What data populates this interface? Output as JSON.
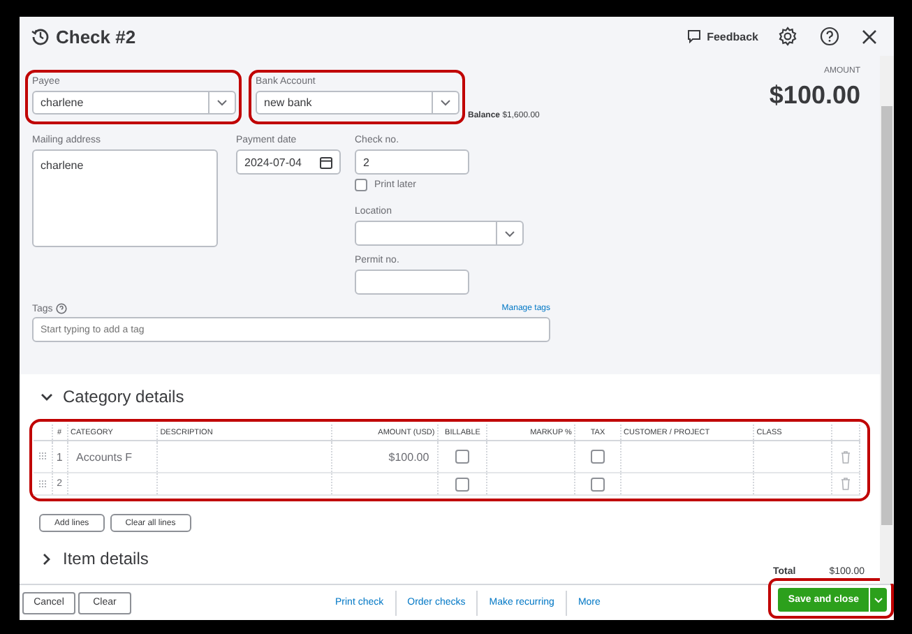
{
  "header": {
    "title": "Check #2",
    "feedback": "Feedback"
  },
  "payee": {
    "label": "Payee",
    "value": "charlene",
    "highlighted": true
  },
  "bank_account": {
    "label": "Bank Account",
    "value": "new bank",
    "highlighted": true,
    "balance_label": "Balance",
    "balance": "$1,600.00"
  },
  "amount": {
    "label": "AMOUNT",
    "value": "$100.00"
  },
  "mailing_address": {
    "label": "Mailing address",
    "value": "charlene"
  },
  "payment_date": {
    "label": "Payment date",
    "value": "2024-07-04"
  },
  "check_no": {
    "label": "Check no.",
    "value": "2"
  },
  "print_later": {
    "label": "Print later",
    "checked": false
  },
  "location": {
    "label": "Location"
  },
  "permit_no": {
    "label": "Permit no."
  },
  "tags": {
    "label": "Tags",
    "placeholder": "Start typing to add a tag",
    "manage": "Manage tags"
  },
  "category_details": {
    "title": "Category details",
    "expanded": true,
    "highlighted": true,
    "columns": [
      "#",
      "CATEGORY",
      "DESCRIPTION",
      "AMOUNT (USD)",
      "BILLABLE",
      "MARKUP %",
      "TAX",
      "CUSTOMER / PROJECT",
      "CLASS"
    ],
    "rows": [
      {
        "number": "1",
        "category": "Accounts F",
        "amount": "$100.00",
        "billable": false,
        "tax": false
      },
      {
        "number": "2",
        "billable": false,
        "tax": false
      }
    ],
    "buttons": [
      "Add lines",
      "Clear all lines"
    ]
  },
  "item_details": {
    "title": "Item details",
    "expanded": false
  },
  "total": {
    "label": "Total",
    "value": "$100.00"
  },
  "footer": {
    "left_buttons": [
      "Cancel",
      "Clear"
    ],
    "links": [
      "Print check",
      "Order checks",
      "Make recurring",
      "More"
    ],
    "save": {
      "label": "Save and close",
      "highlighted": true
    }
  }
}
